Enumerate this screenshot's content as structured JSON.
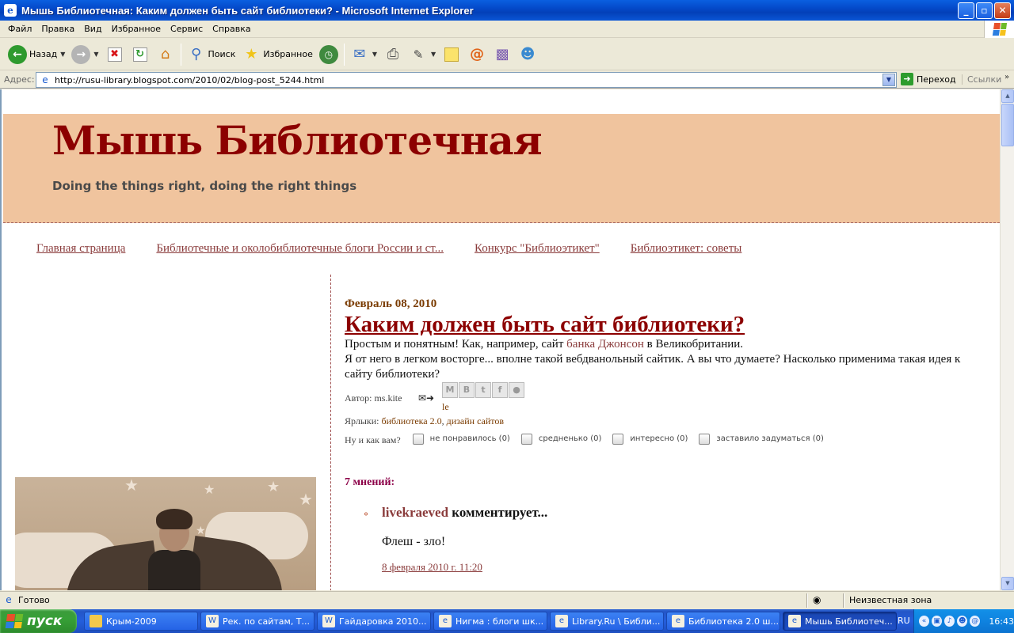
{
  "window": {
    "title": "Мышь Библиотечная: Каким должен быть сайт библиотеки? - Microsoft Internet Explorer",
    "buttons": {
      "minimize": "_",
      "maximize": "▫",
      "close": "✕"
    }
  },
  "menu": [
    "Файл",
    "Правка",
    "Вид",
    "Избранное",
    "Сервис",
    "Справка"
  ],
  "toolbar": {
    "back": "Назад",
    "search": "Поиск",
    "favorites": "Избранное"
  },
  "address": {
    "label": "Адрес:",
    "url": "http://rusu-library.blogspot.com/2010/02/blog-post_5244.html",
    "go": "Переход",
    "links": "Ссылки"
  },
  "blog": {
    "title": "Мышь Библиотечная",
    "description": "Doing the things right, doing the right things",
    "nav": [
      "Главная страница",
      "Библиотечные и околобиблиотечные блоги России и ст...",
      "Конкурс \"Библиоэтикет\"",
      "Библиоэтикет: советы"
    ]
  },
  "post": {
    "date": "Февраль 08, 2010",
    "title": "Каким должен быть сайт библиотеки?",
    "body_line1_prefix": "Простым и понятным! Как, например, сайт ",
    "body_line1_link": "банка Джонсон",
    "body_line1_suffix": " в Великобритании.",
    "body_line2": "Я от него в легком восторге... вполне такой вебдванольный сайтик. А вы что думаете? Насколько применима такая идея к сайту библиотеки?",
    "author": "Автор: ms.kite",
    "share_extra": "le",
    "labels_prefix": "Ярлыки: ",
    "labels": [
      "библиотека 2.0",
      "дизайн сайтов"
    ],
    "labels_sep": ", ",
    "rating_question": "Ну и как вам?",
    "rating_options": [
      "не понравилось (0)",
      "средненько (0)",
      "интересно (0)",
      "заставило задуматься (0)"
    ]
  },
  "comments": {
    "count_label": "7 мнений:",
    "items": [
      {
        "author": "livekraeved",
        "verb": " комментирует...",
        "text": "Флеш - зло!",
        "time": "8 февраля 2010 г. 11:20"
      }
    ]
  },
  "status": {
    "text": "Готово",
    "zone": "Неизвестная зона"
  },
  "taskbar": {
    "start": "пуск",
    "tasks": [
      "Крым-2009",
      "Рек. по сайтам, Т...",
      "Гайдаровка 2010...",
      "Нигма : блоги шк...",
      "Library.Ru \\ Библи...",
      "Библиотека 2.0 ш...",
      "Мышь Библиотеч..."
    ],
    "lang": "RU",
    "clock": "16:43"
  },
  "colors": {
    "header_band": "#f0c49e",
    "blog_title": "#8c0000",
    "link": "#8a3b3b"
  }
}
